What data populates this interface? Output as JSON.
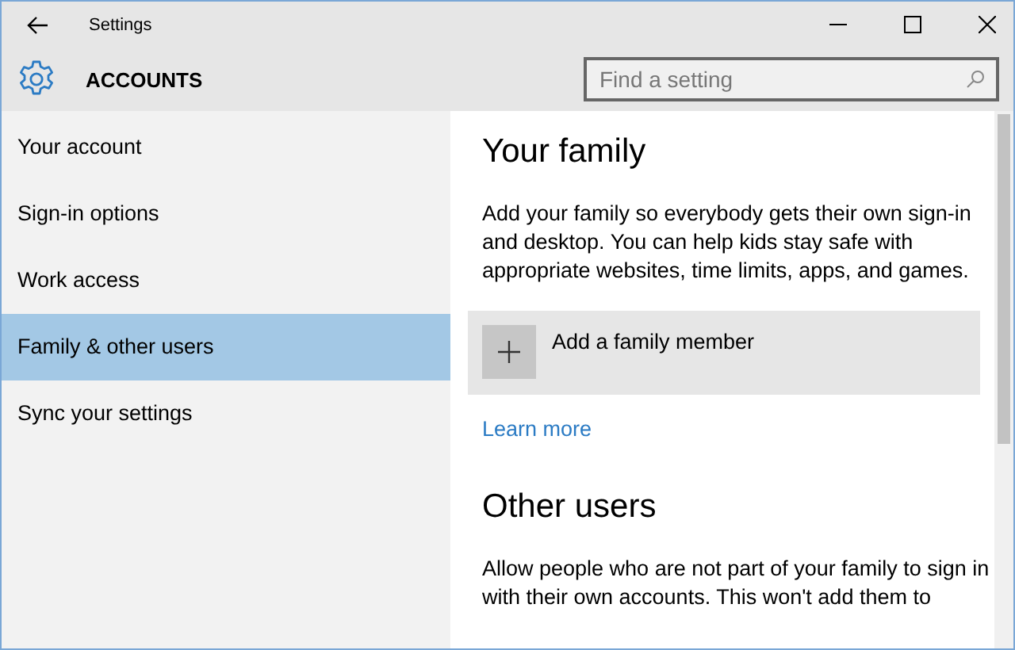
{
  "window": {
    "title": "Settings"
  },
  "header": {
    "title": "ACCOUNTS",
    "search": {
      "placeholder": "Find a setting"
    }
  },
  "sidebar": {
    "items": [
      {
        "label": "Your account",
        "selected": false
      },
      {
        "label": "Sign-in options",
        "selected": false
      },
      {
        "label": "Work access",
        "selected": false
      },
      {
        "label": "Family & other users",
        "selected": true
      },
      {
        "label": "Sync your settings",
        "selected": false
      }
    ]
  },
  "content": {
    "family": {
      "heading": "Your family",
      "description": "Add your family so everybody gets their own sign-in and desktop. You can help kids stay safe with appropriate websites, time limits, apps, and games.",
      "add_button": "Add a family member",
      "link": "Learn more"
    },
    "other_users": {
      "heading": "Other users",
      "description": "Allow people who are not part of your family to sign in with their own accounts. This won't add them to"
    }
  }
}
